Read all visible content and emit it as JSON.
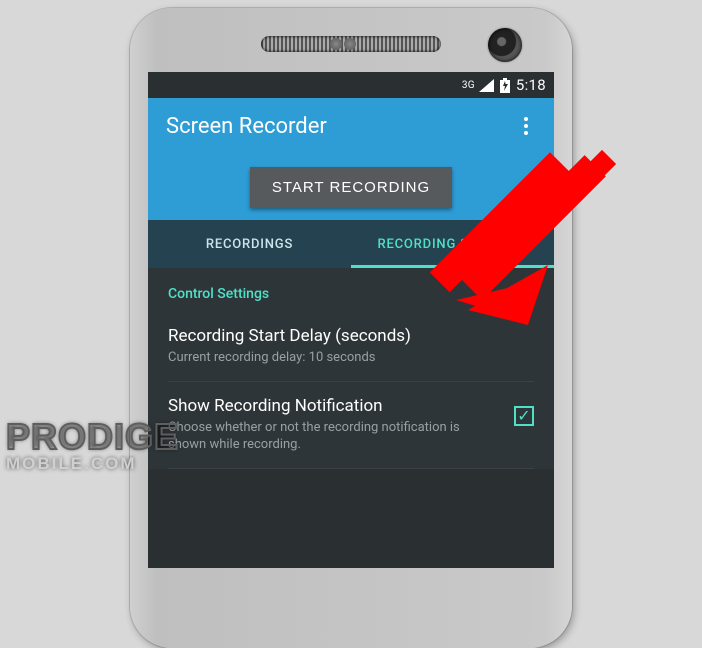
{
  "statusbar": {
    "network_label": "3G",
    "time": "5:18"
  },
  "appbar": {
    "title": "Screen Recorder"
  },
  "action": {
    "start_label": "START RECORDING"
  },
  "tabs": {
    "recordings": "RECORDINGS",
    "settings": "RECORDING SETTINGS"
  },
  "settings": {
    "section_header": "Control Settings",
    "items": [
      {
        "primary": "Recording Start Delay (seconds)",
        "secondary": "Current recording delay: 10 seconds",
        "checkbox": false
      },
      {
        "primary": "Show Recording Notification",
        "secondary": "Choose whether or not the recording notification is shown while recording.",
        "checkbox": true,
        "checked": true
      }
    ]
  },
  "watermark": {
    "line1": "PRODIGE",
    "line2": "MOBILE.COM"
  },
  "colors": {
    "brand_blue": "#2e9dd6",
    "accent_teal": "#4fe0c7",
    "dark_bg": "#2e3538",
    "arrow": "#ff0000"
  }
}
